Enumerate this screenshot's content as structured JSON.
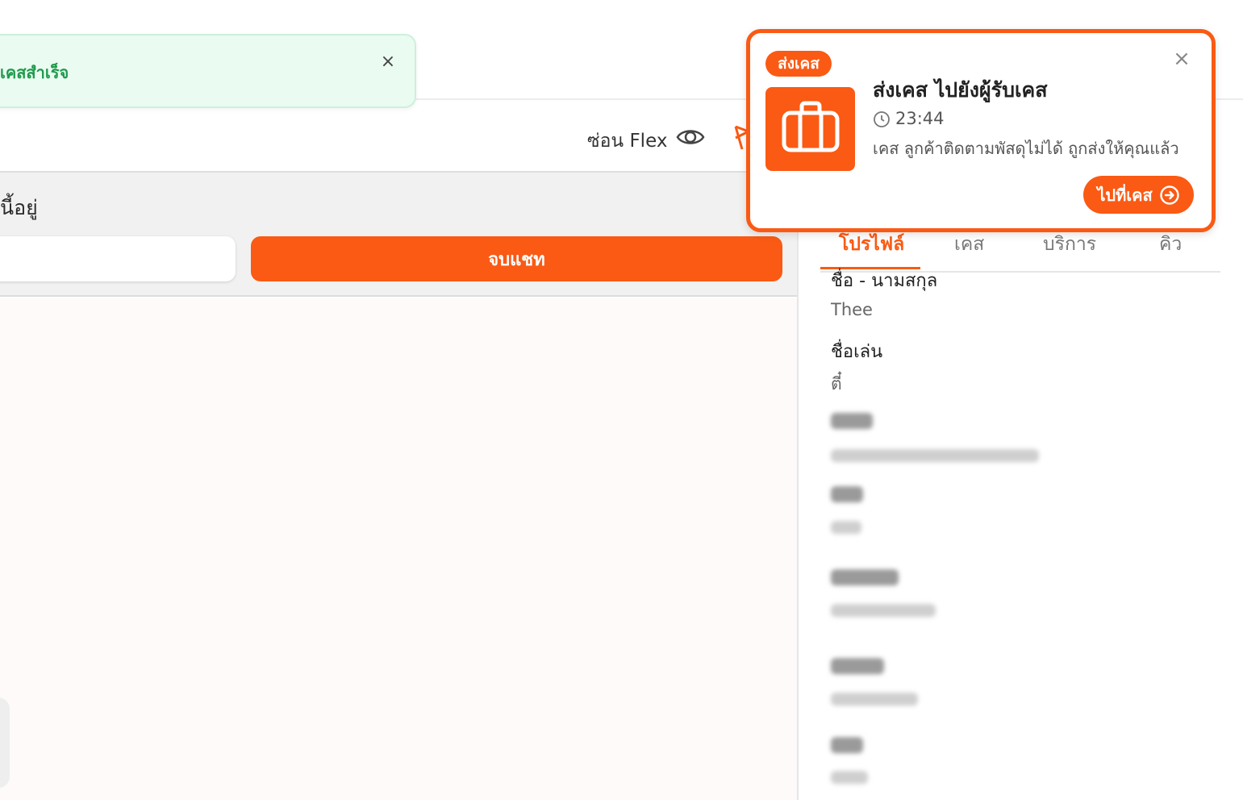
{
  "toast_success": {
    "text": "เคสสำเร็จ",
    "close": "×"
  },
  "toolbar": {
    "hide_flex_label": "ซ่อน Flex",
    "eye_icon": "eye-icon",
    "flag_icon": "flag-icon"
  },
  "status_row": {
    "text": "นี้อยู่",
    "end_chat_label": "จบแชท"
  },
  "tabs": [
    {
      "label": "โปรไฟล์"
    },
    {
      "label": "เคส"
    },
    {
      "label": "บริการ"
    },
    {
      "label": "คิว"
    }
  ],
  "profile": {
    "name_label": "ชื่อ - นามสกุล",
    "name_value": "Thee",
    "nickname_label": "ชื่อเล่น",
    "nickname_value": "ตี๋"
  },
  "notification": {
    "badge": "ส่งเคส",
    "title": "ส่งเคส ไปยังผู้รับเคส",
    "time": "23:44",
    "body": "เคส ลูกค้าติดตามพัสดุไม่ได้ ถูกส่งให้คุณแล้ว",
    "goto_label": "ไปที่เคส",
    "close": "×"
  },
  "colors": {
    "accent": "#fa5a14",
    "success_text": "#1f9a4c",
    "success_bg": "#eafbf1"
  }
}
